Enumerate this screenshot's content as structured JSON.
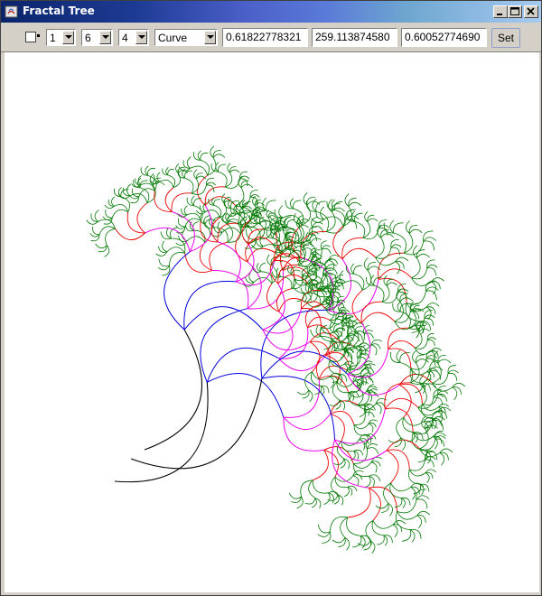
{
  "window": {
    "title": "Fractal Tree"
  },
  "titlebar_buttons": [
    "minimize-icon",
    "maximize-icon",
    "close-icon"
  ],
  "toolbar": {
    "checkbox_checked": false,
    "combo1": {
      "value": "1"
    },
    "combo2": {
      "value": "6"
    },
    "combo3": {
      "value": "4"
    },
    "mode_select": {
      "value": "Curve"
    },
    "field1": "0.61822778321",
    "field2": "259.113874580",
    "field3": "0.60052774690",
    "set_label": "Set"
  },
  "canvas": {
    "background": "#ffffff",
    "depth_colors": [
      "#000000",
      "#0000dd",
      "#ee00ee",
      "#ee0000",
      "#007700"
    ]
  }
}
